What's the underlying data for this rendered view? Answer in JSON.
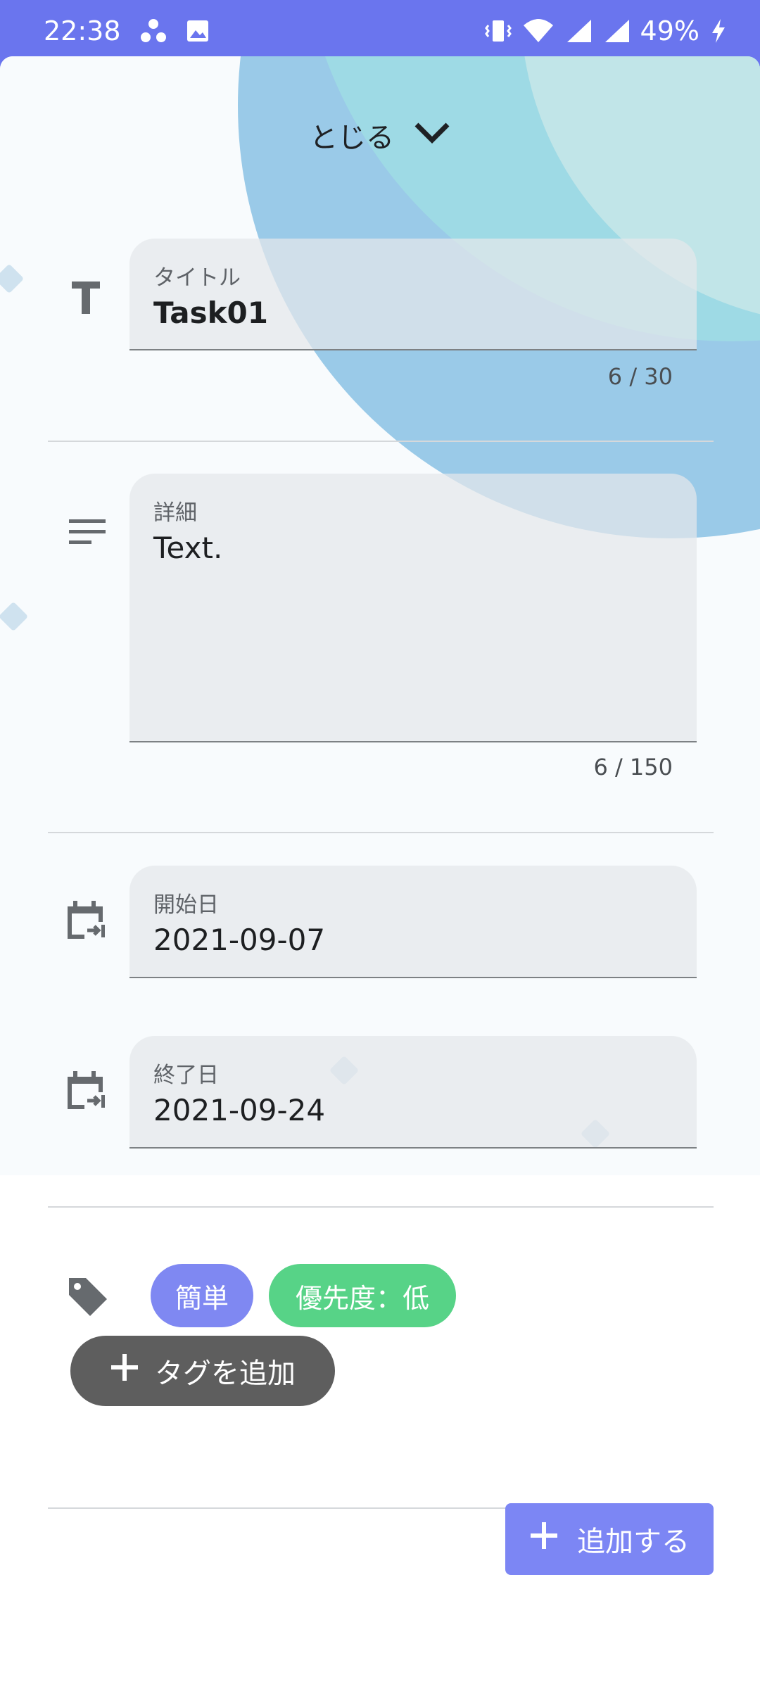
{
  "status_bar": {
    "time": "22:38",
    "battery": "49%",
    "icons": [
      "cluster-icon",
      "image-icon",
      "vibrate-icon",
      "wifi-icon",
      "signal-icon",
      "charging-icon"
    ]
  },
  "header": {
    "close_label": "とじる",
    "close_icon": "chevron-down-icon"
  },
  "form": {
    "title": {
      "label": "タイトル",
      "value": "Task01",
      "counter": "6 / 30",
      "icon": "title-icon"
    },
    "details": {
      "label": "詳細",
      "value": "Text.",
      "counter": "6 / 150",
      "icon": "notes-icon"
    },
    "start_date": {
      "label": "開始日",
      "value": "2021-09-07",
      "icon": "calendar-arrow-icon"
    },
    "end_date": {
      "label": "終了日",
      "value": "2021-09-24",
      "icon": "calendar-arrow-icon"
    }
  },
  "tags": {
    "icon": "tag-icon",
    "items": [
      {
        "label": "簡単",
        "color": "#7f88f2"
      },
      {
        "label": "優先度：低",
        "color": "#57d387"
      }
    ],
    "add_label": "タグを追加"
  },
  "submit": {
    "label": "追加する",
    "color": "#7c86f4"
  },
  "colors": {
    "accent": "#6a75ee"
  }
}
